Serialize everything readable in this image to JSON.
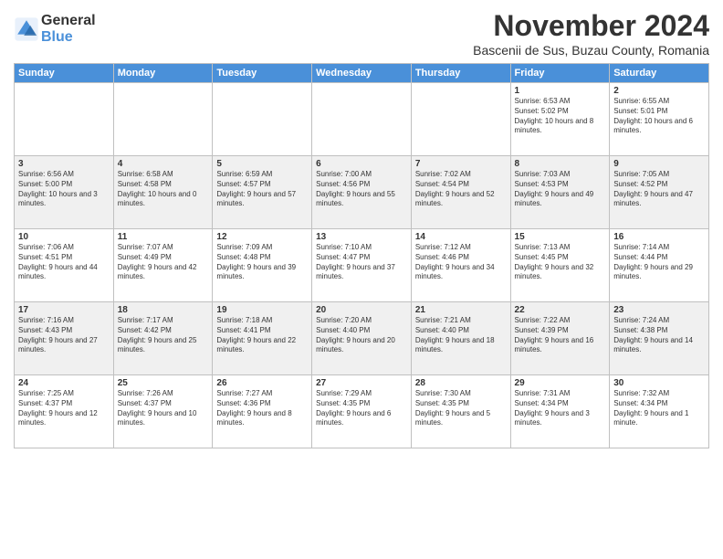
{
  "logo": {
    "line1": "General",
    "line2": "Blue"
  },
  "title": "November 2024",
  "location": "Bascenii de Sus, Buzau County, Romania",
  "days_of_week": [
    "Sunday",
    "Monday",
    "Tuesday",
    "Wednesday",
    "Thursday",
    "Friday",
    "Saturday"
  ],
  "weeks": [
    [
      {
        "day": "",
        "info": ""
      },
      {
        "day": "",
        "info": ""
      },
      {
        "day": "",
        "info": ""
      },
      {
        "day": "",
        "info": ""
      },
      {
        "day": "",
        "info": ""
      },
      {
        "day": "1",
        "info": "Sunrise: 6:53 AM\nSunset: 5:02 PM\nDaylight: 10 hours and 8 minutes."
      },
      {
        "day": "2",
        "info": "Sunrise: 6:55 AM\nSunset: 5:01 PM\nDaylight: 10 hours and 6 minutes."
      }
    ],
    [
      {
        "day": "3",
        "info": "Sunrise: 6:56 AM\nSunset: 5:00 PM\nDaylight: 10 hours and 3 minutes."
      },
      {
        "day": "4",
        "info": "Sunrise: 6:58 AM\nSunset: 4:58 PM\nDaylight: 10 hours and 0 minutes."
      },
      {
        "day": "5",
        "info": "Sunrise: 6:59 AM\nSunset: 4:57 PM\nDaylight: 9 hours and 57 minutes."
      },
      {
        "day": "6",
        "info": "Sunrise: 7:00 AM\nSunset: 4:56 PM\nDaylight: 9 hours and 55 minutes."
      },
      {
        "day": "7",
        "info": "Sunrise: 7:02 AM\nSunset: 4:54 PM\nDaylight: 9 hours and 52 minutes."
      },
      {
        "day": "8",
        "info": "Sunrise: 7:03 AM\nSunset: 4:53 PM\nDaylight: 9 hours and 49 minutes."
      },
      {
        "day": "9",
        "info": "Sunrise: 7:05 AM\nSunset: 4:52 PM\nDaylight: 9 hours and 47 minutes."
      }
    ],
    [
      {
        "day": "10",
        "info": "Sunrise: 7:06 AM\nSunset: 4:51 PM\nDaylight: 9 hours and 44 minutes."
      },
      {
        "day": "11",
        "info": "Sunrise: 7:07 AM\nSunset: 4:49 PM\nDaylight: 9 hours and 42 minutes."
      },
      {
        "day": "12",
        "info": "Sunrise: 7:09 AM\nSunset: 4:48 PM\nDaylight: 9 hours and 39 minutes."
      },
      {
        "day": "13",
        "info": "Sunrise: 7:10 AM\nSunset: 4:47 PM\nDaylight: 9 hours and 37 minutes."
      },
      {
        "day": "14",
        "info": "Sunrise: 7:12 AM\nSunset: 4:46 PM\nDaylight: 9 hours and 34 minutes."
      },
      {
        "day": "15",
        "info": "Sunrise: 7:13 AM\nSunset: 4:45 PM\nDaylight: 9 hours and 32 minutes."
      },
      {
        "day": "16",
        "info": "Sunrise: 7:14 AM\nSunset: 4:44 PM\nDaylight: 9 hours and 29 minutes."
      }
    ],
    [
      {
        "day": "17",
        "info": "Sunrise: 7:16 AM\nSunset: 4:43 PM\nDaylight: 9 hours and 27 minutes."
      },
      {
        "day": "18",
        "info": "Sunrise: 7:17 AM\nSunset: 4:42 PM\nDaylight: 9 hours and 25 minutes."
      },
      {
        "day": "19",
        "info": "Sunrise: 7:18 AM\nSunset: 4:41 PM\nDaylight: 9 hours and 22 minutes."
      },
      {
        "day": "20",
        "info": "Sunrise: 7:20 AM\nSunset: 4:40 PM\nDaylight: 9 hours and 20 minutes."
      },
      {
        "day": "21",
        "info": "Sunrise: 7:21 AM\nSunset: 4:40 PM\nDaylight: 9 hours and 18 minutes."
      },
      {
        "day": "22",
        "info": "Sunrise: 7:22 AM\nSunset: 4:39 PM\nDaylight: 9 hours and 16 minutes."
      },
      {
        "day": "23",
        "info": "Sunrise: 7:24 AM\nSunset: 4:38 PM\nDaylight: 9 hours and 14 minutes."
      }
    ],
    [
      {
        "day": "24",
        "info": "Sunrise: 7:25 AM\nSunset: 4:37 PM\nDaylight: 9 hours and 12 minutes."
      },
      {
        "day": "25",
        "info": "Sunrise: 7:26 AM\nSunset: 4:37 PM\nDaylight: 9 hours and 10 minutes."
      },
      {
        "day": "26",
        "info": "Sunrise: 7:27 AM\nSunset: 4:36 PM\nDaylight: 9 hours and 8 minutes."
      },
      {
        "day": "27",
        "info": "Sunrise: 7:29 AM\nSunset: 4:35 PM\nDaylight: 9 hours and 6 minutes."
      },
      {
        "day": "28",
        "info": "Sunrise: 7:30 AM\nSunset: 4:35 PM\nDaylight: 9 hours and 5 minutes."
      },
      {
        "day": "29",
        "info": "Sunrise: 7:31 AM\nSunset: 4:34 PM\nDaylight: 9 hours and 3 minutes."
      },
      {
        "day": "30",
        "info": "Sunrise: 7:32 AM\nSunset: 4:34 PM\nDaylight: 9 hours and 1 minute."
      }
    ]
  ]
}
